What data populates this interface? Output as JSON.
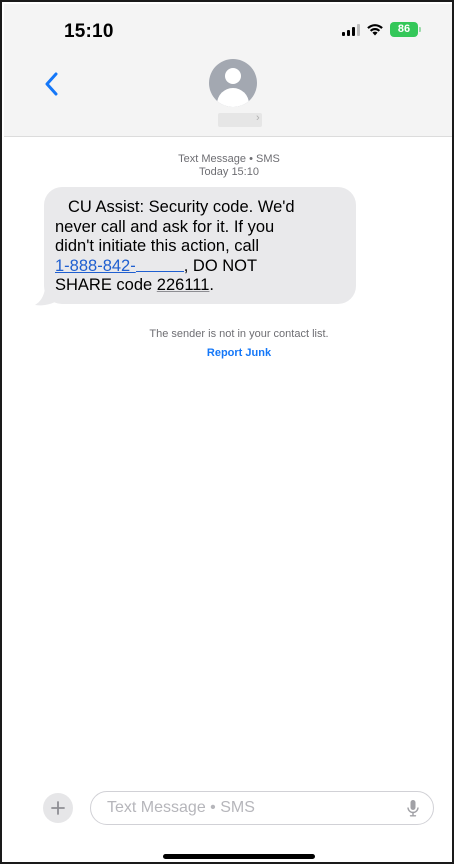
{
  "status_bar": {
    "time": "15:10",
    "battery": "86",
    "battery_color": "#34c759"
  },
  "header": {
    "back_icon": "chevron-left-icon",
    "avatar_icon": "person-avatar-icon",
    "chevron": "›"
  },
  "thread": {
    "channel_label": "Text Message • SMS",
    "timestamp": "Today 15:10",
    "message": {
      "line1": "CU Assist: Security code. We'd",
      "line2": "never call and ask for it. If you",
      "line3": "didn't initiate this action, call",
      "phone_link": "1-888-842-",
      "line4_rest": ", DO NOT",
      "line5_prefix": "SHARE code ",
      "code": "226111",
      "line5_suffix": "."
    },
    "notice": "The sender is not in your contact list.",
    "report_junk": "Report Junk"
  },
  "composer": {
    "plus_icon": "plus-icon",
    "placeholder": "Text Message • SMS",
    "value": "",
    "mic_icon": "microphone-icon"
  },
  "colors": {
    "accent": "#1477f8",
    "link": "#1f5fd0",
    "bubble": "#e9e9eb"
  }
}
